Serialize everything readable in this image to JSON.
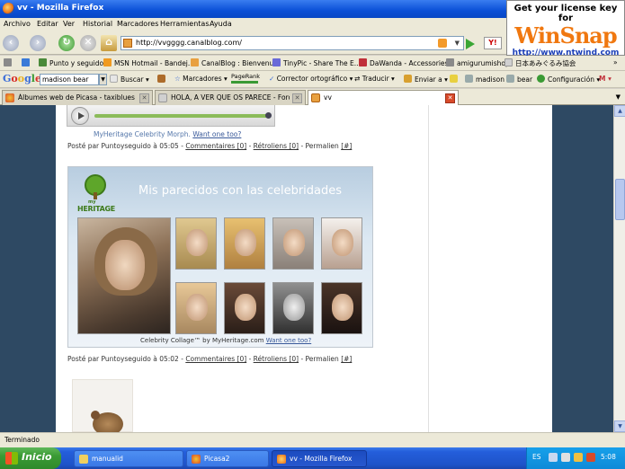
{
  "window": {
    "title": "vv - Mozilla Firefox"
  },
  "ad": {
    "line1": "Get your license key for",
    "brand": "WinSnap",
    "url": "http://www.ntwind.com"
  },
  "menu": [
    "Archivo",
    "Editar",
    "Ver",
    "Historial",
    "Marcadores",
    "Herramientas",
    "Ayuda"
  ],
  "navigation": {
    "url": "http://vvgggg.canalblog.com/"
  },
  "bookmarks": [
    {
      "label": "Punto y seguido",
      "color": "#4a8a3a"
    },
    {
      "label": "MSN Hotmail - Bandej...",
      "color": "#f09a20"
    },
    {
      "label": "CanalBlog : Bienvenue",
      "color": "#e8a040"
    },
    {
      "label": "TinyPic - Share The E...",
      "color": "#6a6ad8"
    },
    {
      "label": "DaWanda - Accessories",
      "color": "#c0303a"
    },
    {
      "label": "amigurumishop",
      "color": "#8a8a8a"
    },
    {
      "label": "日本あみぐるみ協会",
      "color": "#d0d0d0"
    }
  ],
  "google_toolbar": {
    "logo": "Google",
    "search_value": "madison bear",
    "buscar": "Buscar",
    "marcadores": "Marcadores",
    "pagerank": "PageRank",
    "corrector": "Corrector ortográfico",
    "traducir": "Traducir",
    "enviar": "Enviar a",
    "term1": "madison",
    "term2": "bear",
    "configuracion": "Configuración"
  },
  "tabs": [
    {
      "label": "Álbumes web de Picasa - taxiblues - F...",
      "active": false
    },
    {
      "label": "HOLA, A VER QUE OS PARECE - Foro ...",
      "active": false
    },
    {
      "label": "vv",
      "active": true
    }
  ],
  "page": {
    "widget_caption": "MyHeritage Celebrity Morph.",
    "widget_link": "Want one too?",
    "post1": {
      "prefix": "Posté par Puntoyseguido à 05:05 - ",
      "comments": "Commentaires [0]",
      "sep1": " - ",
      "trackbacks": "Rétroliens [0]",
      "sep2": " - Permalien ",
      "permalink": "[#]"
    },
    "collage": {
      "logo_top": "my",
      "logo_brand": "HERITAGE",
      "title": "Mis parecidos con las celebridades",
      "caption": "Celebrity Collage™ by MyHeritage.com ",
      "caption_link": "Want one too?"
    },
    "post2": {
      "prefix": "Posté par Puntoyseguido à 05:02 - ",
      "comments": "Commentaires [0]",
      "sep1": " - ",
      "trackbacks": "Rétroliens [0]",
      "sep2": " - Permalien ",
      "permalink": "[#]"
    }
  },
  "status": {
    "text": "Terminado"
  },
  "taskbar": {
    "start": "Inicio",
    "items": [
      {
        "label": "manualid",
        "active": false
      },
      {
        "label": "Picasa2",
        "active": false
      },
      {
        "label": "vv - Mozilla Firefox",
        "active": true
      }
    ],
    "lang": "ES",
    "clock": "5:08"
  }
}
